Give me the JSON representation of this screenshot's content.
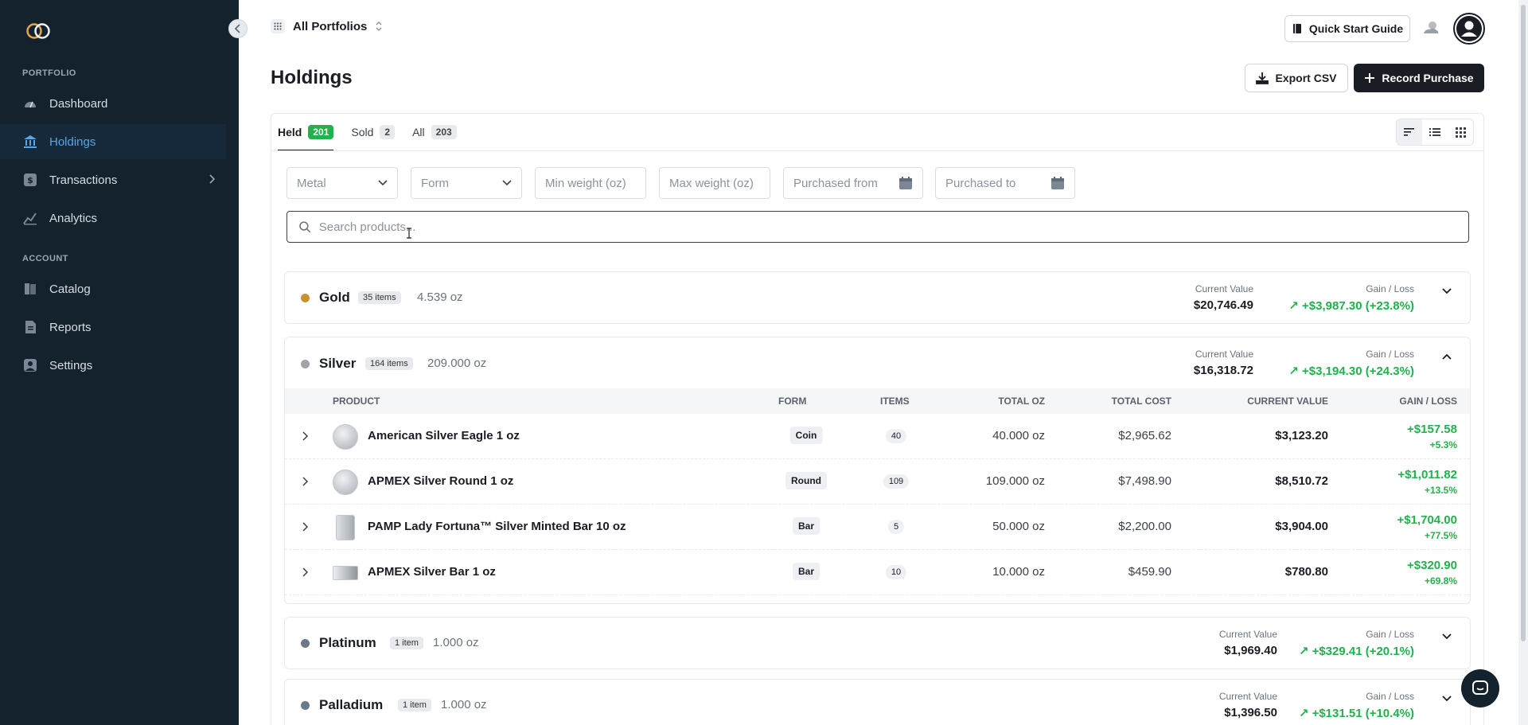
{
  "sidebar": {
    "sections": {
      "portfolio": "PORTFOLIO",
      "account": "ACCOUNT"
    },
    "items": [
      {
        "label": "Dashboard",
        "icon": "gauge-icon"
      },
      {
        "label": "Holdings",
        "icon": "bank-icon"
      },
      {
        "label": "Transactions",
        "icon": "dollar-icon"
      },
      {
        "label": "Analytics",
        "icon": "chart-icon"
      },
      {
        "label": "Catalog",
        "icon": "book-icon"
      },
      {
        "label": "Reports",
        "icon": "document-icon"
      },
      {
        "label": "Settings",
        "icon": "user-icon"
      }
    ]
  },
  "topbar": {
    "portfolio": "All Portfolios",
    "quick_start": "Quick Start Guide"
  },
  "page": {
    "title": "Holdings",
    "export": "Export CSV",
    "record": "Record Purchase"
  },
  "tabs": [
    {
      "label": "Held",
      "count": "201"
    },
    {
      "label": "Sold",
      "count": "2"
    },
    {
      "label": "All",
      "count": "203"
    }
  ],
  "filters": {
    "metal": "Metal",
    "form": "Form",
    "min_weight": "Min weight (oz)",
    "max_weight": "Max weight (oz)",
    "purchased_from": "Purchased from",
    "purchased_to": "Purchased to",
    "search_placeholder": "Search products..."
  },
  "labels": {
    "current_value": "Current Value",
    "gain_loss": "Gain / Loss"
  },
  "groups": {
    "gold": {
      "name": "Gold",
      "count": "35 items",
      "oz": "4.539 oz",
      "value": "$20,746.49",
      "gain": "+$3,987.30 (+23.8%)",
      "color": "#c9932b"
    },
    "silver": {
      "name": "Silver",
      "count": "164 items",
      "oz": "209.000 oz",
      "value": "$16,318.72",
      "gain": "+$3,194.30 (+24.3%)",
      "color": "#a0a4a9"
    },
    "platinum": {
      "name": "Platinum",
      "count": "1 item",
      "oz": "1.000 oz",
      "value": "$1,969.40",
      "gain": "+$329.41 (+20.1%)",
      "color": "#6b7a86"
    },
    "palladium": {
      "name": "Palladium",
      "count": "1 item",
      "oz": "1.000 oz",
      "value": "$1,396.50",
      "gain": "+$131.51 (+10.4%)",
      "color": "#6b7a86"
    }
  },
  "table": {
    "headers": {
      "product": "PRODUCT",
      "form": "FORM",
      "items": "ITEMS",
      "total_oz": "TOTAL OZ",
      "total_cost": "TOTAL COST",
      "current_value": "CURRENT VALUE",
      "gain_loss": "GAIN / LOSS"
    },
    "rows": [
      {
        "product": "American Silver Eagle 1 oz",
        "form": "Coin",
        "items": "40",
        "total_oz": "40.000 oz",
        "total_cost": "$2,965.62",
        "current_value": "$3,123.20",
        "gain": "+$157.58",
        "pct": "+5.3%"
      },
      {
        "product": "APMEX Silver Round 1 oz",
        "form": "Round",
        "items": "109",
        "total_oz": "109.000 oz",
        "total_cost": "$7,498.90",
        "current_value": "$8,510.72",
        "gain": "+$1,011.82",
        "pct": "+13.5%"
      },
      {
        "product": "PAMP Lady Fortuna™ Silver Minted Bar 10 oz",
        "form": "Bar",
        "items": "5",
        "total_oz": "50.000 oz",
        "total_cost": "$2,200.00",
        "current_value": "$3,904.00",
        "gain": "+$1,704.00",
        "pct": "+77.5%"
      },
      {
        "product": "APMEX Silver Bar 1 oz",
        "form": "Bar",
        "items": "10",
        "total_oz": "10.000 oz",
        "total_cost": "$459.90",
        "current_value": "$780.80",
        "gain": "+$320.90",
        "pct": "+69.8%"
      }
    ]
  }
}
